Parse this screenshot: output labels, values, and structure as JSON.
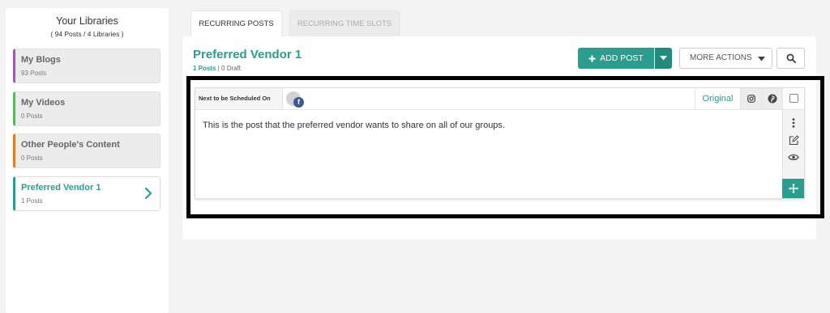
{
  "sidebar": {
    "title": "Your Libraries",
    "subtitle": "( 94 Posts / 4 Libraries )",
    "libraries": [
      {
        "name": "My Blogs",
        "count": "93 Posts",
        "accent": "#a05bb5"
      },
      {
        "name": "My Videos",
        "count": "0 Posts",
        "accent": "#5cb85c"
      },
      {
        "name": "Other People's Content",
        "count": "0 Posts",
        "accent": "#e07b26"
      },
      {
        "name": "Preferred Vendor 1",
        "count": "1 Posts",
        "accent": "#2a9d8f"
      }
    ]
  },
  "tabs": {
    "recurring_posts": "RECURRING POSTS",
    "recurring_time_slots": "RECURRING TIME SLOTS"
  },
  "library": {
    "title": "Preferred Vendor 1",
    "posts_count": "1 Posts",
    "separator": "|",
    "draft_count": "0 Draft"
  },
  "toolbar": {
    "add_post_label": "ADD POST",
    "more_actions_label": "MORE ACTIONS"
  },
  "post": {
    "next_scheduled_label": "Next to be Scheduled On",
    "network_badge": "f",
    "original_tab": "Original",
    "text": "This is the post that the preferred vendor wants to share on all of our groups."
  },
  "colors": {
    "accent": "#2a9d8f",
    "facebook": "#3b5998"
  },
  "icons": [
    "plus-icon",
    "caret-down-icon",
    "search-icon",
    "chevron-right-icon",
    "facebook-icon",
    "instagram-icon",
    "pinterest-icon",
    "more-vertical-icon",
    "edit-icon",
    "eye-icon",
    "move-icon"
  ]
}
